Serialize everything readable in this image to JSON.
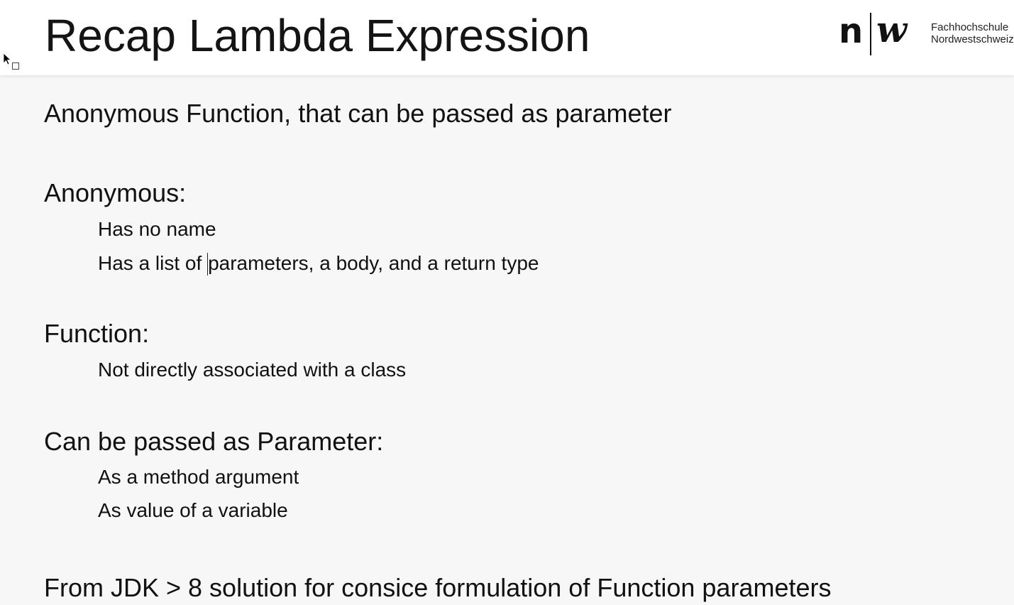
{
  "header": {
    "title": "Recap Lambda Expression",
    "logo": {
      "letter_n": "n",
      "letter_w": "w",
      "line1": "Fachhochschule",
      "line2": "Nordwestschweiz"
    }
  },
  "body": {
    "intro": "Anonymous Function, that can be passed as parameter",
    "sections": [
      {
        "heading": "Anonymous:",
        "items": [
          "Has no name",
          "Has a list of ",
          "parameters, a body, and a return type"
        ]
      },
      {
        "heading": "Function:",
        "items": [
          "Not directly associated with a class"
        ]
      },
      {
        "heading": "Can be passed as Parameter:",
        "items": [
          "As a method argument",
          "As value of a variable"
        ]
      }
    ],
    "footer_line": "From JDK > 8 solution for consice formulation of Function parameters"
  },
  "colors": {
    "header_bg": "#ffffff",
    "content_bg": "#f7f7f7",
    "text": "#111111"
  },
  "icons": {
    "cursor": "mouse-pointer-icon",
    "logo": "fhnw-logo-icon"
  }
}
